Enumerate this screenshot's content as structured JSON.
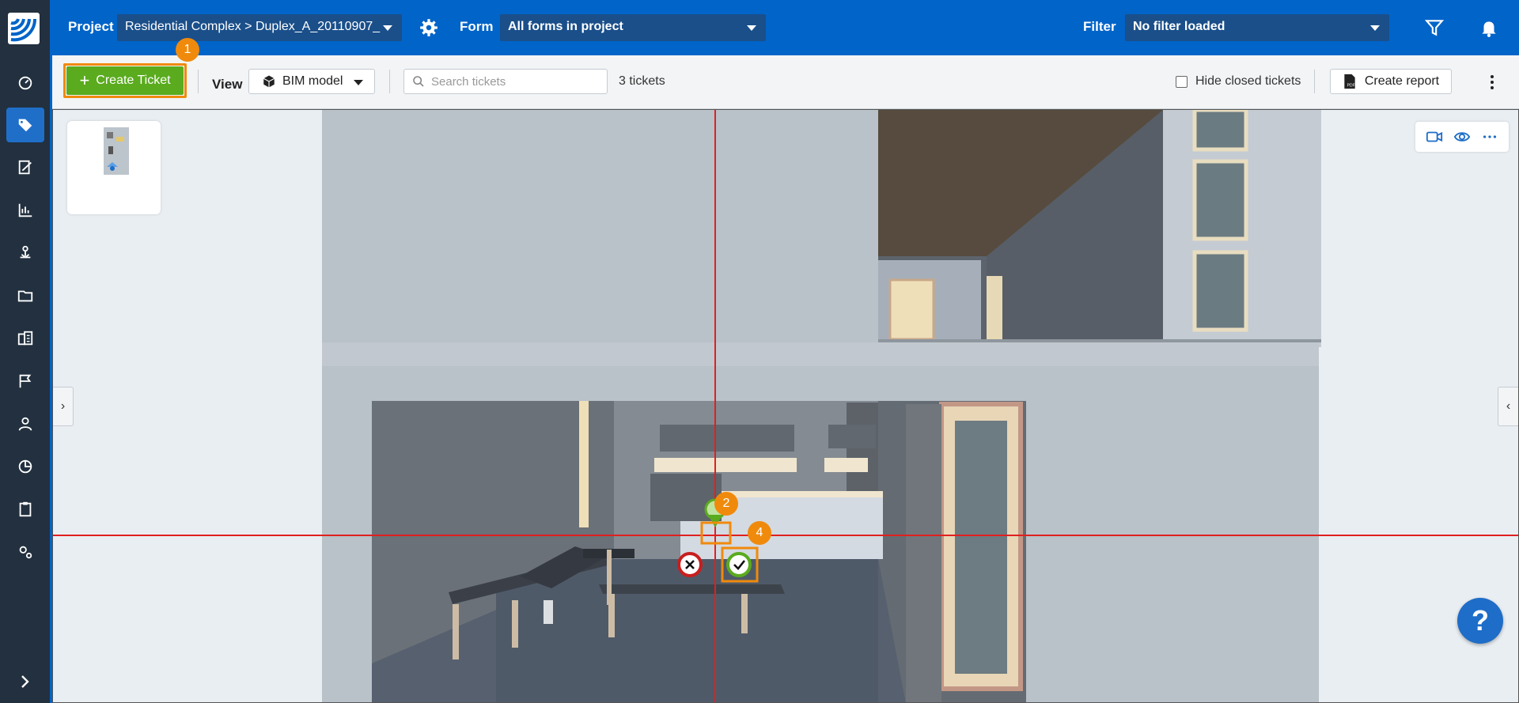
{
  "header": {
    "project_label": "Project",
    "project_value": "Residential Complex > Duplex_A_20110907_",
    "form_label": "Form",
    "form_value": "All forms in project",
    "filter_label": "Filter",
    "filter_value": "No filter loaded"
  },
  "toolbar": {
    "create_ticket_label": "Create Ticket",
    "view_label": "View",
    "view_value": "BIM model",
    "search_placeholder": "Search tickets",
    "ticket_count": "3 tickets",
    "hide_closed_label": "Hide closed tickets",
    "hide_closed_checked": false,
    "create_report_label": "Create report"
  },
  "annotations": {
    "badge_1": "1",
    "badge_2": "2",
    "badge_4": "4"
  },
  "help_label": "?",
  "colors": {
    "header_bg": "#0064c8",
    "sidebar_bg": "#22303f",
    "create_btn": "#5aab1e",
    "highlight": "#f08a0c",
    "crosshair": "#e02020",
    "help_btn": "#1e6dc8"
  },
  "sidebar_icons": [
    "dashboard-icon",
    "tickets-icon",
    "forms-icon",
    "reports-icon",
    "bim-icon",
    "folder-icon",
    "buildings-icon",
    "flag-icon",
    "user-icon",
    "chart-pie-icon",
    "clipboard-icon",
    "settings-icon"
  ]
}
